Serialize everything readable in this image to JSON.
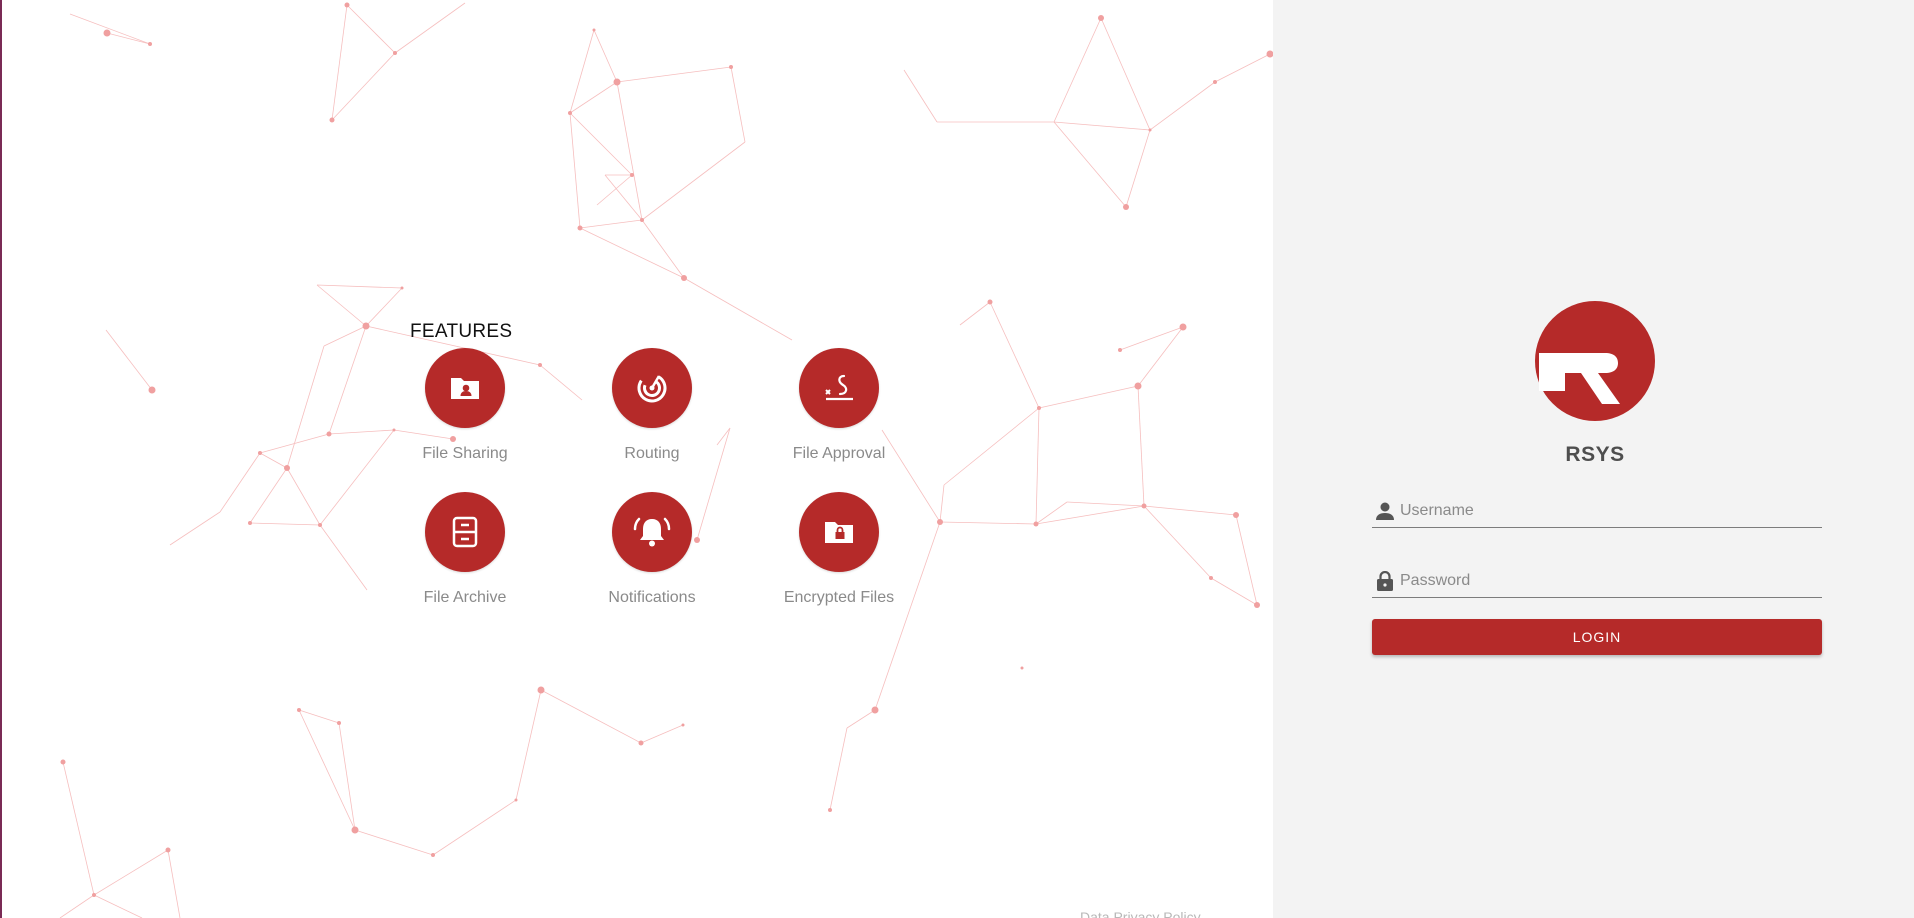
{
  "features": {
    "title": "FEATURES",
    "items": [
      {
        "label": "File Sharing",
        "icon": "folder-user-icon"
      },
      {
        "label": "Routing",
        "icon": "routing-target-icon"
      },
      {
        "label": "File Approval",
        "icon": "signature-icon"
      },
      {
        "label": "File Archive",
        "icon": "archive-cabinet-icon"
      },
      {
        "label": "Notifications",
        "icon": "bell-icon"
      },
      {
        "label": "Encrypted Files",
        "icon": "locked-folder-icon"
      }
    ]
  },
  "login": {
    "brand": "RSYS",
    "username_placeholder": "Username",
    "password_placeholder": "Password",
    "login_label": "LOGIN"
  },
  "footer": {
    "link_text": "Data Privacy Policy"
  },
  "colors": {
    "accent": "#b52a29",
    "panel_bg": "#f3f3f3",
    "network": "#f08c8c"
  }
}
